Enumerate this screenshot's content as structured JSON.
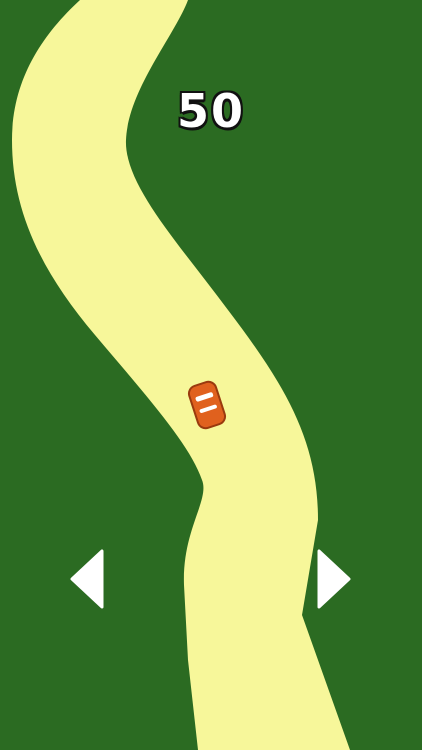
{
  "game": {
    "score": "50",
    "colors": {
      "grass": "#2b6b22",
      "road": "#f7f79a",
      "car_body": "#e0611e",
      "car_outline": "#9a3a0e",
      "arrow": "#ffffff"
    }
  },
  "controls": {
    "left_icon": "arrow-left-icon",
    "right_icon": "arrow-right-icon"
  }
}
